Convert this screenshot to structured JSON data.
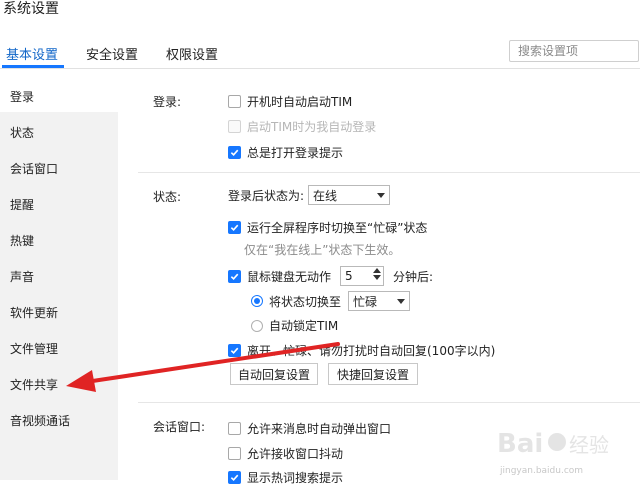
{
  "window": {
    "title": "系统设置"
  },
  "tabs": [
    {
      "label": "基本设置"
    },
    {
      "label": "安全设置"
    },
    {
      "label": "权限设置"
    }
  ],
  "search": {
    "placeholder": "搜索设置项"
  },
  "sidebar": {
    "items": [
      {
        "label": "登录"
      },
      {
        "label": "状态"
      },
      {
        "label": "会话窗口"
      },
      {
        "label": "提醒"
      },
      {
        "label": "热键"
      },
      {
        "label": "声音"
      },
      {
        "label": "软件更新"
      },
      {
        "label": "文件管理"
      },
      {
        "label": "文件共享"
      },
      {
        "label": "音视频通话"
      }
    ]
  },
  "login": {
    "label": "登录:",
    "options": [
      {
        "text": "开机时自动启动TIM",
        "checked": false,
        "disabled": false
      },
      {
        "text": "启动TIM时为我自动登录",
        "checked": false,
        "disabled": true
      },
      {
        "text": "总是打开登录提示",
        "checked": true,
        "disabled": false
      }
    ]
  },
  "status": {
    "label": "状态:",
    "after_login_label": "登录后状态为:",
    "after_login_value": "在线",
    "fullscreen_busy": {
      "text": "运行全屏程序时切换至“忙碌”状态",
      "checked": true
    },
    "fullscreen_hint": "仅在“我在线上”状态下生效。",
    "idle": {
      "text": "鼠标键盘无动作",
      "checked": true,
      "minutes": "5",
      "suffix": "分钟后:"
    },
    "idle_switch": {
      "text": "将状态切换至",
      "value": "忙碌",
      "selected": true
    },
    "idle_lock": {
      "text": "自动锁定TIM",
      "selected": false
    },
    "auto_reply": {
      "text": "离开、忙碌、请勿打扰时自动回复(100字以内)",
      "checked": true
    },
    "auto_reply_button": "自动回复设置",
    "quick_reply_button": "快捷回复设置"
  },
  "session": {
    "label": "会话窗口:",
    "options": [
      {
        "text": "允许来消息时自动弹出窗口",
        "checked": false
      },
      {
        "text": "允许接收窗口抖动",
        "checked": false
      },
      {
        "text": "显示热词搜索提示",
        "checked": true
      }
    ]
  },
  "watermark": {
    "brand": "Baidu经验",
    "url": "jingyan.baidu.com"
  },
  "colors": {
    "accent": "#1677ff",
    "arrow": "#e02424",
    "sidebar_bg": "#f2f2f2"
  }
}
